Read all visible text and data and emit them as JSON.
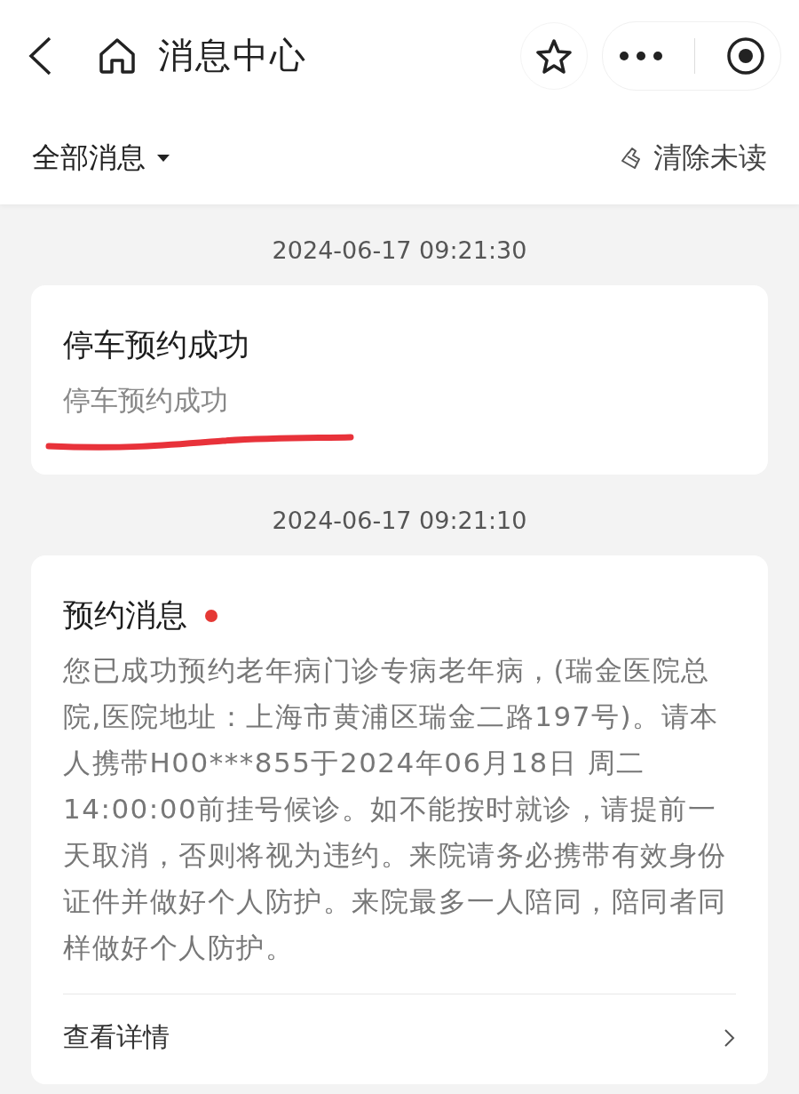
{
  "nav_bar": {
    "title": "消息中心"
  },
  "filter_bar": {
    "filter_label": "全部消息",
    "clear_label": "清除未读"
  },
  "messages": [
    {
      "time": "2024-06-17 09:21:30",
      "title": "停车预约成功",
      "unread": false,
      "summary": "停车预约成功",
      "annotated": true
    },
    {
      "time": "2024-06-17 09:21:10",
      "title": "预约消息",
      "unread": true,
      "body": "您已成功预约老年病门诊专病老年病，(瑞金医院总院,医院地址：上海市黄浦区瑞金二路197号)。请本人携带H00***855于2024年06月18日 周二14:00:00前挂号候诊。如不能按时就诊，请提前一天取消，否则将视为违约。来院请务必携带有效身份证件并做好个人防护。来院最多一人陪同，陪同者同样做好个人防护。",
      "link": "查看详情"
    }
  ]
}
